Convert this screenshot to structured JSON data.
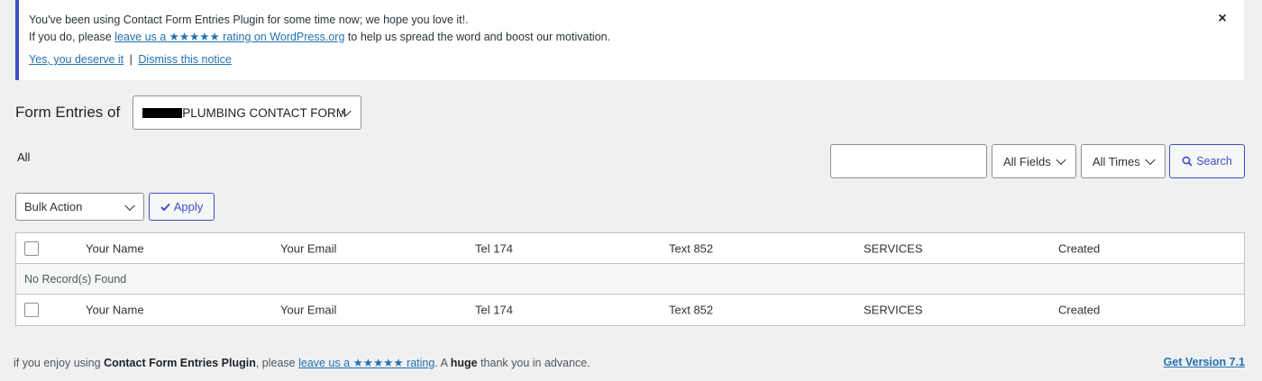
{
  "notice": {
    "line1": "You've been using Contact Form Entries Plugin for some time now; we hope you love it!.",
    "line2_prefix": "If you do, please",
    "line2_link": "leave us a ★★★★★ rating on WordPress.org",
    "line2_suffix": "to help us spread the word and boost our motivation.",
    "yes_link": "Yes, you deserve it",
    "separator": "|",
    "dismiss_link": "Dismiss this notice",
    "close_icon": "×"
  },
  "header": {
    "title": "Form Entries of",
    "form_select_value": "PLUMBING CONTACT FORM"
  },
  "views": {
    "all": "All"
  },
  "search": {
    "placeholder": "",
    "fields_select": "All Fields",
    "times_select": "All Times",
    "button": "Search"
  },
  "bulk": {
    "select_value": "Bulk Action",
    "apply": "Apply"
  },
  "table": {
    "columns": [
      "Your Name",
      "Your Email",
      "Tel 174",
      "Text 852",
      "SERVICES",
      "Created"
    ],
    "empty_message": "No Record(s) Found"
  },
  "footer": {
    "prefix": "if you enjoy using",
    "plugin_name": "Contact Form Entries Plugin",
    "mid": ", please",
    "link": "leave us a ★★★★★ rating",
    "after_link": ". A",
    "huge": "huge",
    "suffix": "thank you in advance.",
    "version": "Get Version 7.1"
  },
  "colors": {
    "accent": "#3c51c6",
    "link": "#2271b1",
    "background": "#f0f0f1"
  }
}
